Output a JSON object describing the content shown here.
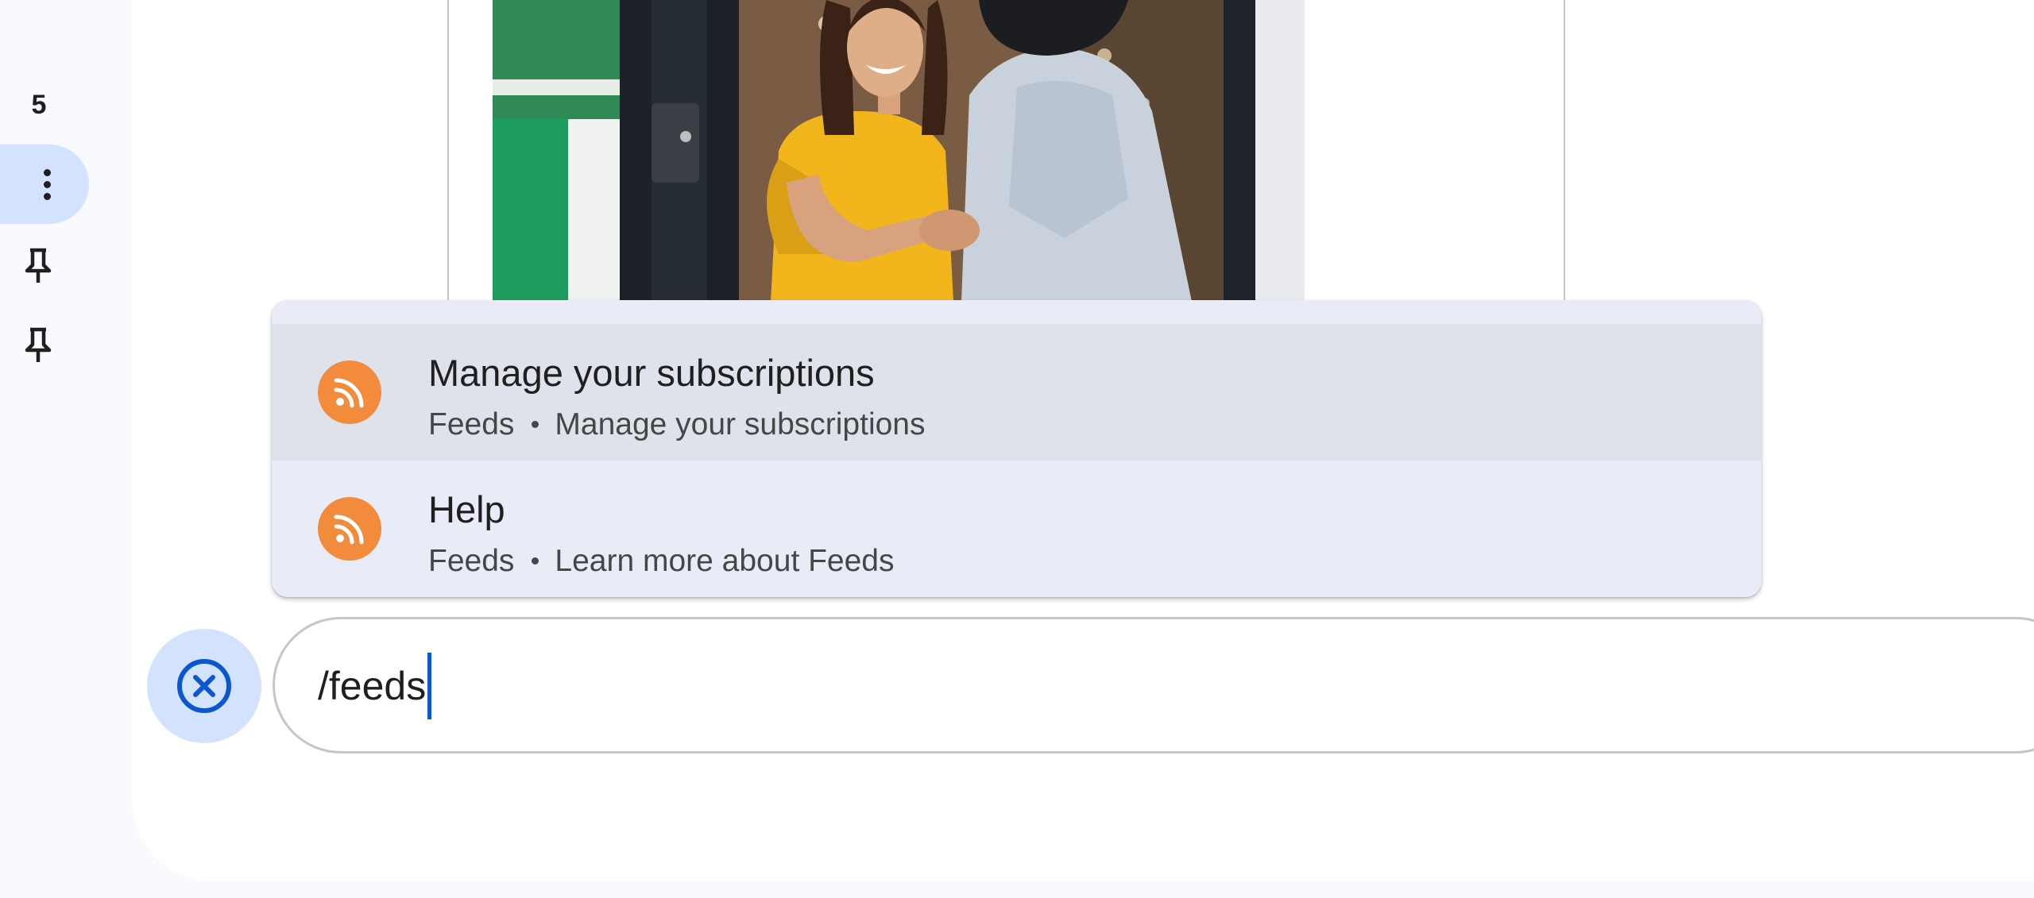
{
  "rail": {
    "count": "5",
    "items": [
      {
        "icon": "more-vert-icon",
        "active": true
      },
      {
        "icon": "pin-icon"
      },
      {
        "icon": "pin-icon"
      }
    ]
  },
  "chat": {
    "image": {
      "subject": "photo-handshake"
    }
  },
  "autocomplete": {
    "items": [
      {
        "title": "Manage your subscriptions",
        "source": "Feeds",
        "description": "Manage your subscriptions",
        "icon": "rss-icon",
        "highlighted": true
      },
      {
        "title": "Help",
        "source": "Feeds",
        "description": "Learn more about Feeds",
        "icon": "rss-icon",
        "highlighted": false
      }
    ]
  },
  "compose": {
    "value": "/feeds",
    "cancel_icon": "close-circle-icon"
  },
  "colors": {
    "accent": "#0b57d0",
    "accent_container": "#d3e3fd",
    "app_icon": "#f28b3c",
    "popup_bg": "#e9ebf6",
    "popup_highlight": "#dfe2ea"
  }
}
